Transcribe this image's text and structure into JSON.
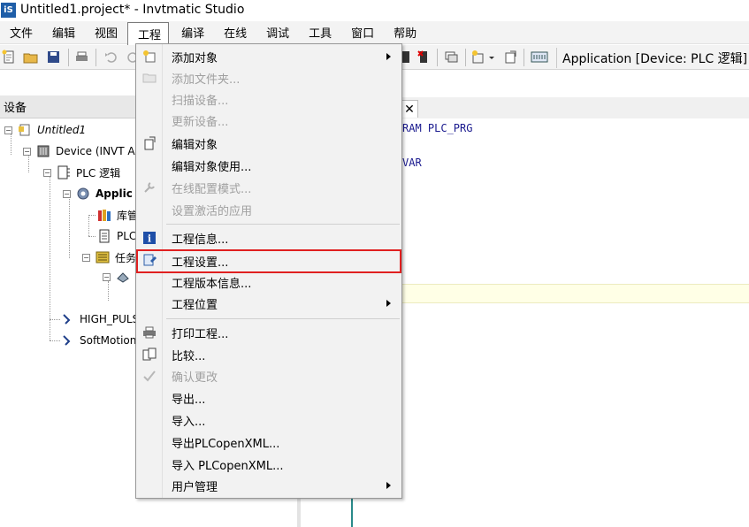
{
  "window": {
    "title": "Untitled1.project* - Invtmatic Studio",
    "logo_text": "iS"
  },
  "menubar": {
    "items": [
      {
        "label": "文件"
      },
      {
        "label": "编辑"
      },
      {
        "label": "视图"
      },
      {
        "label": "工程",
        "active": true
      },
      {
        "label": "编译"
      },
      {
        "label": "在线"
      },
      {
        "label": "调试"
      },
      {
        "label": "工具"
      },
      {
        "label": "窗口"
      },
      {
        "label": "帮助"
      }
    ]
  },
  "toolbar": {
    "active_application": "Application [Device: PLC 逻辑]"
  },
  "device_panel": {
    "title": "设备",
    "tree": [
      {
        "label": "Untitled1",
        "icon": "project-icon"
      },
      {
        "label": "Device (INVT AX",
        "icon": "device-icon"
      },
      {
        "label": "PLC 逻辑",
        "icon": "plc-logic-icon"
      },
      {
        "label": "Applic",
        "icon": "application-gear-icon"
      },
      {
        "label": "库管",
        "icon": "library-icon"
      },
      {
        "label": "PLC",
        "icon": "pou-icon"
      },
      {
        "label": "任务",
        "icon": "task-config-icon"
      },
      {
        "label": "",
        "icon": "task-icon"
      },
      {
        "label": "HIGH_PULS",
        "icon": "axis-icon"
      },
      {
        "label": "SoftMotion",
        "icon": "softmotion-icon"
      }
    ]
  },
  "editor": {
    "tab_close": "✕",
    "code_line1": "RAM PLC_PRG",
    "code_line2": "VAR"
  },
  "project_menu": {
    "items": [
      {
        "label": "添加对象",
        "icon": "add-object-icon",
        "enabled": true,
        "submenu": true
      },
      {
        "label": "添加文件夹...",
        "icon": "folder-icon",
        "enabled": false,
        "submenu": false
      },
      {
        "label": "扫描设备...",
        "icon": "",
        "enabled": false,
        "submenu": false
      },
      {
        "label": "更新设备...",
        "icon": "",
        "enabled": false,
        "submenu": false
      },
      {
        "label": "编辑对象",
        "icon": "edit-object-icon",
        "enabled": true,
        "submenu": false
      },
      {
        "label": "编辑对象使用...",
        "icon": "",
        "enabled": true,
        "submenu": false
      },
      {
        "label": "在线配置模式...",
        "icon": "wrench-icon",
        "enabled": false,
        "submenu": false
      },
      {
        "label": "设置激活的应用",
        "icon": "",
        "enabled": false,
        "submenu": false
      },
      {
        "label": "工程信息...",
        "icon": "info-icon",
        "enabled": true,
        "submenu": false
      },
      {
        "label": "工程设置...",
        "icon": "project-settings-icon",
        "enabled": true,
        "submenu": false,
        "highlighted": true
      },
      {
        "label": "工程版本信息...",
        "icon": "",
        "enabled": true,
        "submenu": false
      },
      {
        "label": "工程位置",
        "icon": "",
        "enabled": true,
        "submenu": true
      },
      {
        "label": "打印工程...",
        "icon": "print-icon",
        "enabled": true,
        "submenu": false
      },
      {
        "label": "比较...",
        "icon": "compare-icon",
        "enabled": true,
        "submenu": false
      },
      {
        "label": "确认更改",
        "icon": "confirm-changes-icon",
        "enabled": false,
        "submenu": false
      },
      {
        "label": "导出...",
        "icon": "",
        "enabled": true,
        "submenu": false
      },
      {
        "label": "导入...",
        "icon": "",
        "enabled": true,
        "submenu": false
      },
      {
        "label": "导出PLCopenXML...",
        "icon": "",
        "enabled": true,
        "submenu": false
      },
      {
        "label": "导入 PLCopenXML...",
        "icon": "",
        "enabled": true,
        "submenu": false
      },
      {
        "label": "用户管理",
        "icon": "",
        "enabled": true,
        "submenu": true
      }
    ]
  },
  "colors": {
    "highlight_border": "#e02020",
    "disabled_text": "#a0a0a0",
    "code_keyword": "#1a1a8e"
  }
}
